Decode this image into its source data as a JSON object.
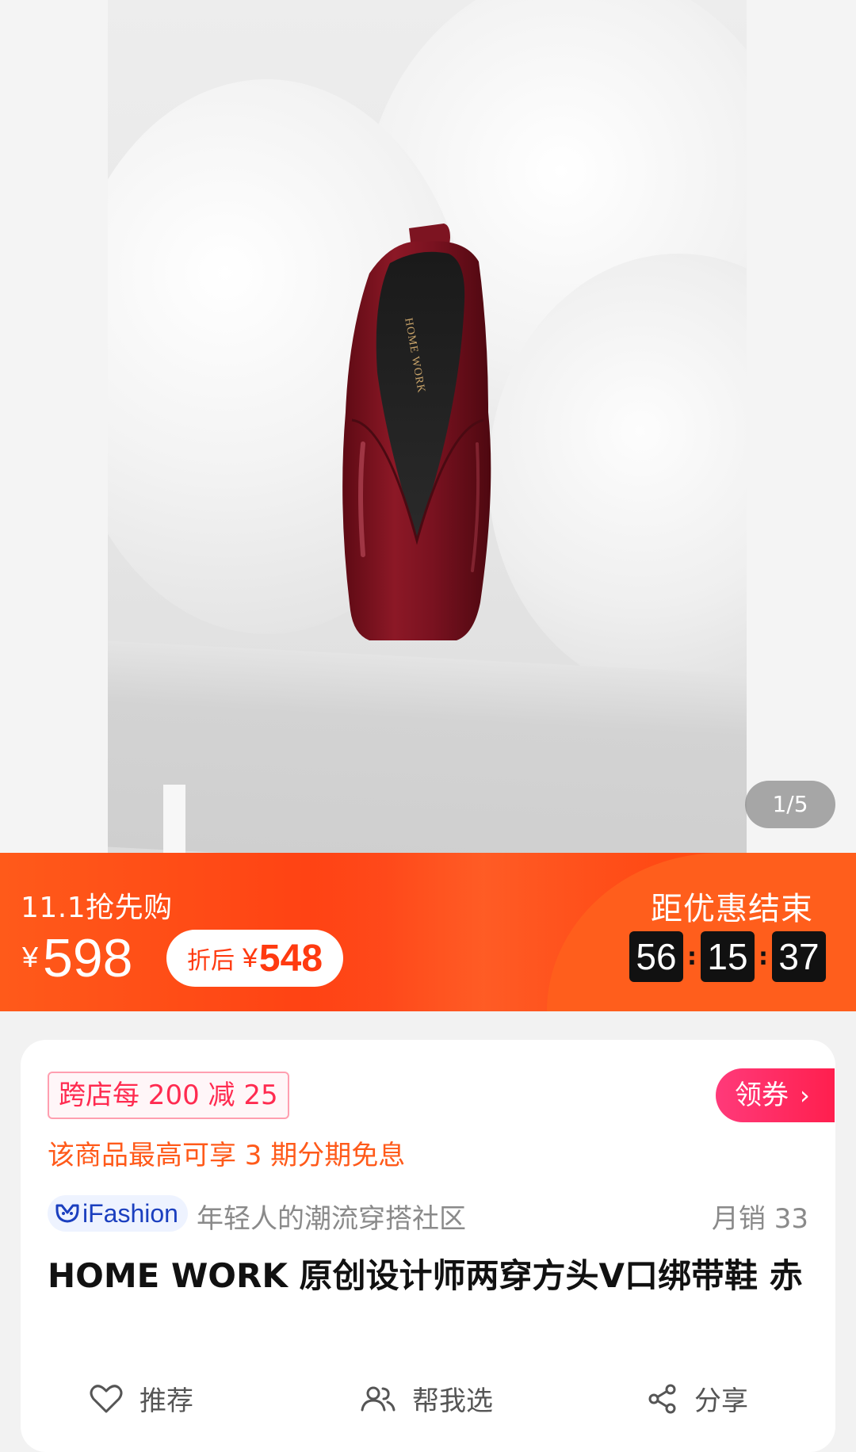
{
  "gallery": {
    "page_indicator": "1/5",
    "shoe_brand_print": "HOME WORK"
  },
  "promo": {
    "event_label": "11.1抢先购",
    "currency": "¥",
    "price": "598",
    "after_label": "折后",
    "after_currency": "¥",
    "after_price": "548",
    "countdown_label": "距优惠结束",
    "countdown": [
      "56",
      "15",
      "37"
    ],
    "countdown_sep": ":",
    "colors": {
      "accent": "#ff4a14",
      "countdown_bg": "#111111"
    }
  },
  "info": {
    "coupon_tag": "跨店每 200 减 25",
    "claim_button": "领券",
    "installment": "该商品最高可享 3 期分期免息",
    "brand_badge": "iFashion",
    "tagline": "年轻人的潮流穿搭社区",
    "monthly_sales": "月销 33",
    "title": "HOME WORK  原创设计师两穿方头V口绑带鞋 赤"
  },
  "actions": [
    {
      "label": "推荐",
      "icon": "heart-icon"
    },
    {
      "label": "帮我选",
      "icon": "people-icon"
    },
    {
      "label": "分享",
      "icon": "share-icon"
    }
  ]
}
